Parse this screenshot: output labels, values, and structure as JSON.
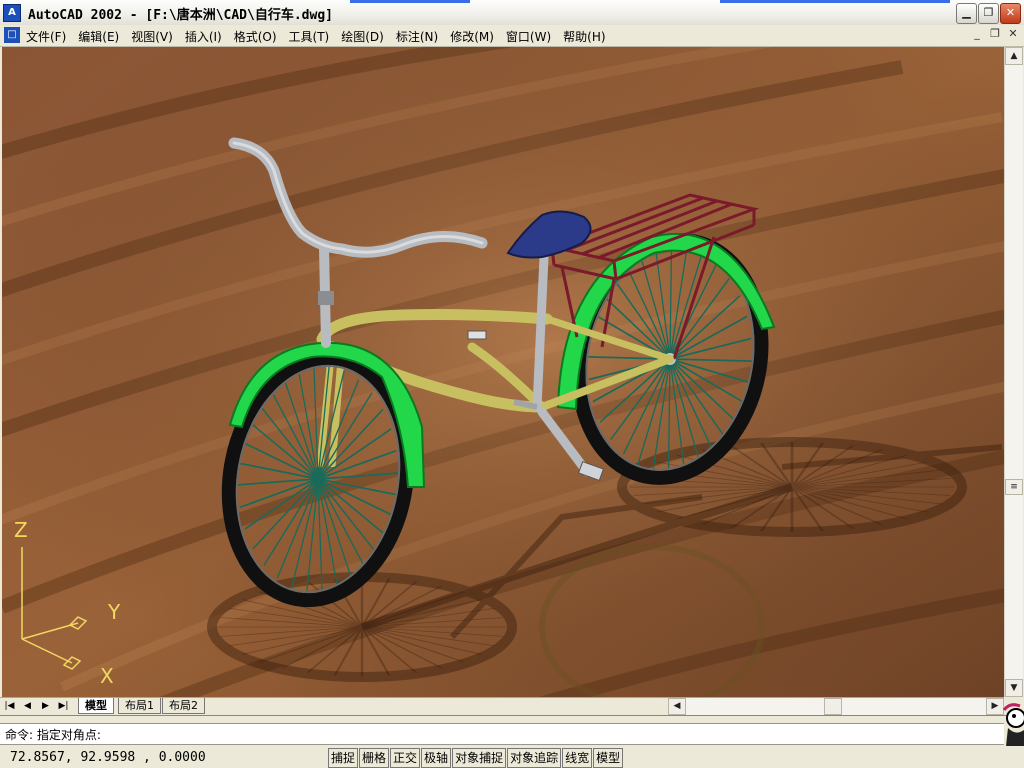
{
  "window": {
    "title": "AutoCAD 2002 - [F:\\唐本洲\\CAD\\自行车.dwg]",
    "app_icon": "autocad-icon"
  },
  "menu": {
    "items": [
      "文件(F)",
      "编辑(E)",
      "视图(V)",
      "插入(I)",
      "格式(O)",
      "工具(T)",
      "绘图(D)",
      "标注(N)",
      "修改(M)",
      "窗口(W)",
      "帮助(H)"
    ]
  },
  "ucs": {
    "z": "Z",
    "y": "Y",
    "x": "X"
  },
  "layout_tabs": [
    "模型",
    "布局1",
    "布局2"
  ],
  "command": {
    "prompt": "命令:",
    "text": "指定对角点:"
  },
  "status": {
    "coordinates": "72.8567, 92.9598 , 0.0000",
    "toggles": [
      "捕捉",
      "栅格",
      "正交",
      "极轴",
      "对象捕捉",
      "对象追踪",
      "线宽",
      "模型"
    ]
  },
  "colors": {
    "wood": "#8a5530",
    "fender": "#22d84a",
    "frame": "#c8c060",
    "rack": "#7a1a2a",
    "saddle": "#2c3a8a",
    "spokes": "#1a6a5a",
    "steel": "#b8bcc0"
  }
}
